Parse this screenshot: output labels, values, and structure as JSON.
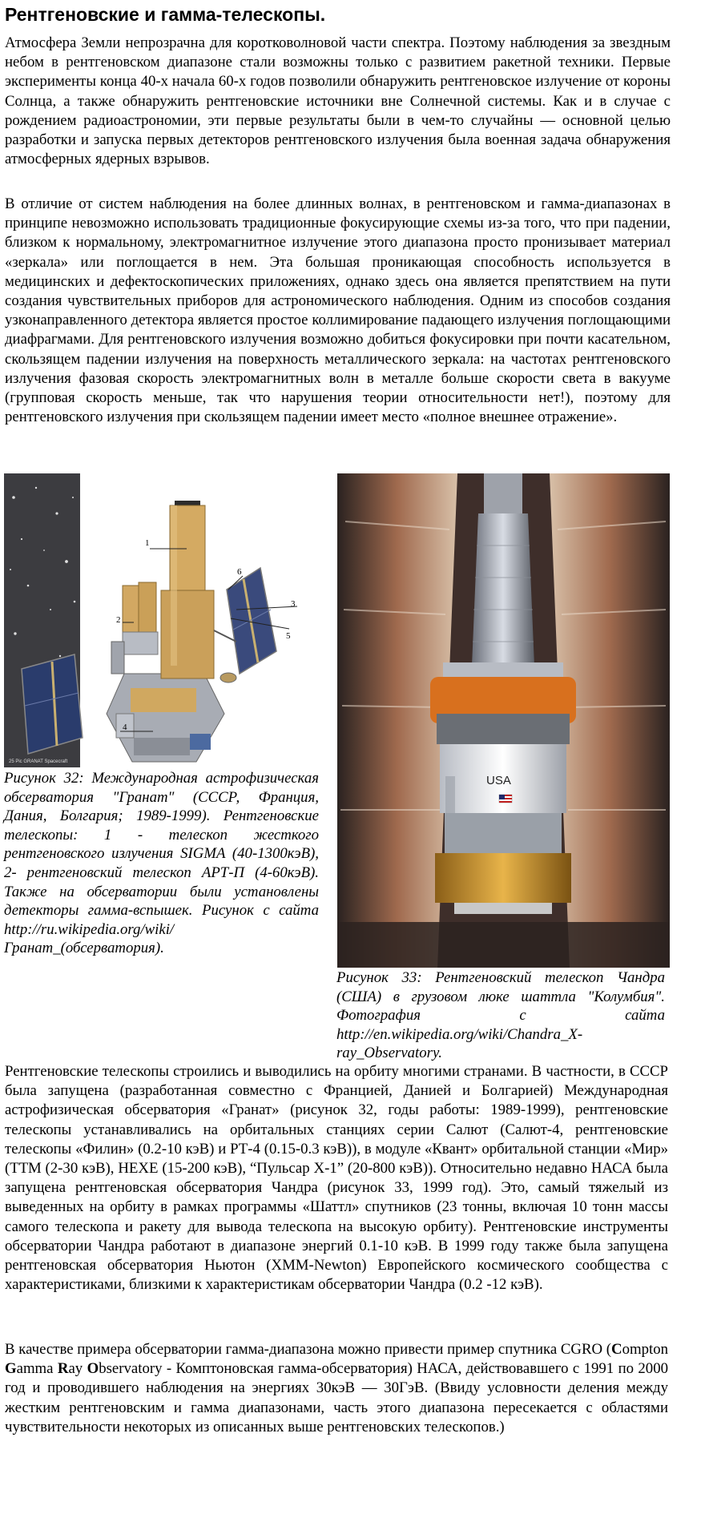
{
  "title": "Рентгеновские и гамма-телескопы.",
  "paragraphs": [
    "Атмосфера Земли непрозрачна для коротковолновой части спектра. Поэтому наблюдения за звездным небом в рентгеновском диапазоне стали возможны только с развитием ракетной техники. Первые эксперименты конца 40-х начала 60-х годов позволили обнаружить рентгеновское излучение от короны Солнца, а также обнаружить рентгеновские источники вне Солнечной системы. Как и в случае с рождением радиоастрономии, эти первые результаты были в чем-то случайны — основной целью разработки и запуска первых детекторов рентгеновского излучения была военная задача обнаружения атмосферных ядерных взрывов.",
    "В отличие от систем наблюдения на более длинных волнах, в рентгеновском и гамма-диапазонах в принципе невозможно использовать традиционные фокусирующие схемы из-за того, что при падении, близком к нормальному, электромагнитное излучение этого диапазона просто пронизывает материал «зеркала» или поглощается в нем. Эта большая проникающая способность используется в медицинских и дефектоскопических приложениях, однако здесь она является препятствием на пути создания чувствительных приборов для астрономического наблюдения.  Одним из способов создания узконаправленного детектора является простое коллимирование падающего излучения поглощающими диафрагмами. Для рентгеновского излучения возможно добиться фокусировки при почти касательном, скользящем падении излучения на поверхность металлического зеркала: на частотах рентгеновского излучения фазовая скорость электромагнитных волн в металле больше скорости света в вакууме (групповая скорость меньше, так что нарушения теории относительности нет!), поэтому для рентгеновского излучения при скользящем падении имеет место «полное внешнее отражение».",
    "Рентгеновские телескопы строились и выводились на орбиту многими странами. В частности, в СССР была запущена (разработанная совместно с Францией, Данией и Болгарией) Международная астрофизическая обсерватория «Гранат» (рисунок 32, годы работы: 1989-1999),  рентгеновские телескопы устанавливались на орбитальных станциях серии Салют (Салют-4, рентгеновские телескопы «Филин» (0.2-10 кэВ) и РТ-4 (0.15-0.3 кэВ)), в модуле «Квант» орбитальной станции «Мир» (ТТМ (2-30 кэВ), НЕХЕ (15-200 кэВ), “Пульсар Х-1” (20-800 кэВ)). Относительно недавно НАСА была запущена рентгеновская обсерватория Чандра (рисунок 33, 1999 год). Это, самый тяжелый из выведенных на орбиту в рамках программы  «Шаттл» спутников (23 тонны, включая 10 тонн массы самого телескопа и ракету для вывода телескопа на высокую орбиту). Рентгеновские инструменты обсерватории Чандра работают в диапазоне энергий 0.1-10 кэВ. В 1999 году также была запущена рентгеновская обсерватория Ньютон (XMM-Newton) Европейского космического сообщества с характеристиками, близкими к характеристикам обсерватории Чандра (0.2 -12 кэВ)."
  ],
  "last_paragraph": {
    "part1": "В качестве примера обсерватории гамма-диапазона можно привести пример спутника CGRO (",
    "c": "C",
    "ompton": "ompton ",
    "g": "G",
    "amma": "amma ",
    "r": "R",
    "ay": "ay ",
    "o": "O",
    "bservatory": "bservatory",
    "part2": " - Комптоновская гамма-обсерватория) НАСА, действовавшего с 1991 по 2000 год и проводившего наблюдения на энергиях 30кэВ — 30ГэВ. (Ввиду условности деления между жестким рентгеновским и гамма диапазонами, часть этого диапазона пересекается с областями чувствительности некоторых из описанных выше рентгеновских телескопов.)"
  },
  "figure32": {
    "caption": "Рисунок 32: Международная астрофизическая обсерватория \"Гранат\" (СССР, Франция, Дания, Болгария; 1989-1999). Рентгеновские телескопы: 1 - телескоп жесткого рентгеновского излучения SIGMA (40-1300кэВ), 2- рентгеновский телескоп АРТ-П (4-60кэВ). Также на обсерватории были установлены детекторы гамма-вспышек. Рисунок с сайта http://ru.wikipedia.org/wiki/Гранат_(обсерватория).",
    "labels": [
      "1",
      "2",
      "3",
      "4",
      "5",
      "6"
    ],
    "credit": "25 Pic GRANAT Spacecraft"
  },
  "figure33": {
    "caption": "Рисунок 33: Рентгеновский телескоп Чандра (США) в грузовом люке шаттла \"Колумбия\". Фотография с сайта http://en.wikipedia.org/wiki/Chandra_X-ray_Observatory.",
    "flag_text": "USA"
  },
  "colors": {
    "text": "#000000",
    "gold": "#c8a050",
    "orange": "#d8701e",
    "bay": "#5a4a44"
  }
}
